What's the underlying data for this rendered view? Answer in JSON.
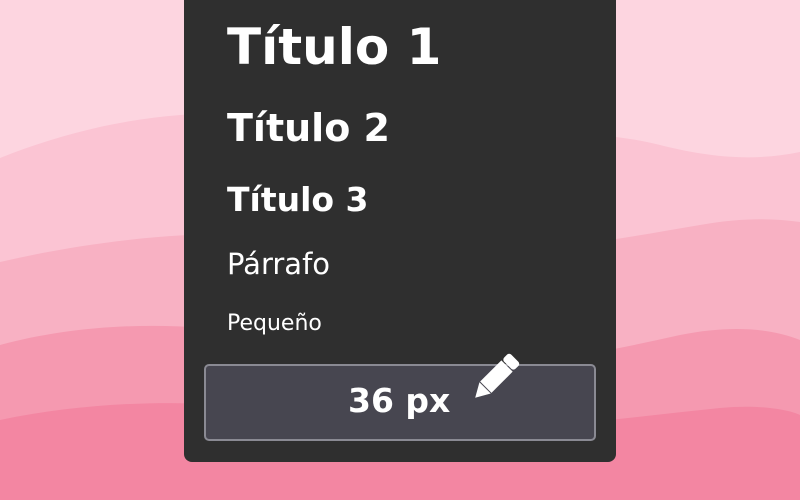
{
  "styles": {
    "h1": "Título 1",
    "h2": "Título 2",
    "h3": "Título 3",
    "paragraph": "Párrafo",
    "small": "Pequeño"
  },
  "size_editor": {
    "value": "36 px",
    "icon": "pencil-icon"
  },
  "colors": {
    "background": "#fdd5e0",
    "panel": "#2f2f2f",
    "field": "#474650",
    "text": "#ffffff"
  }
}
